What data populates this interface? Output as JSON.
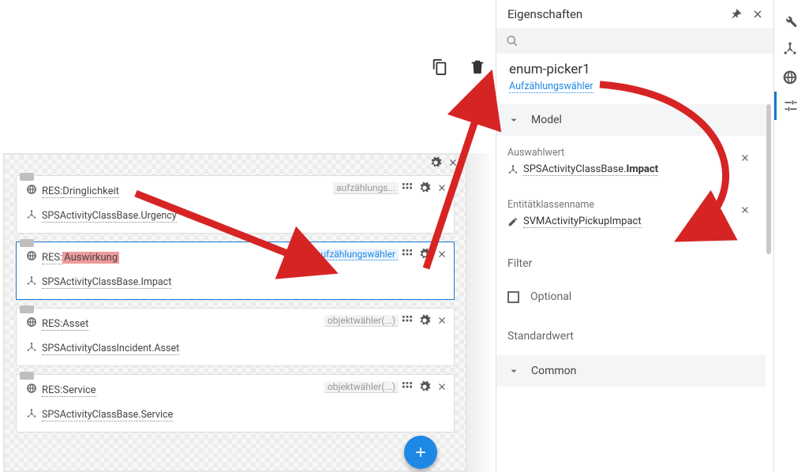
{
  "rail": {
    "items": [
      "wrench",
      "flow",
      "globe",
      "sliders"
    ]
  },
  "properties": {
    "title": "Eigenschaften",
    "component_id": "enum-picker1",
    "component_type": "Aufzählungswähler",
    "sections": {
      "model": {
        "title": "Model",
        "auswahlwert_label": "Auswahlwert",
        "auswahlwert_prefix": "SPSActivityClassBase.",
        "auswahlwert_bold": "Impact",
        "entitaet_label": "Entitätklassenname",
        "entitaet_value": "SVMActivityPickupImpact",
        "filter_label": "Filter",
        "optional_label": "Optional",
        "standardwert_label": "Standardwert"
      },
      "common": {
        "title": "Common"
      }
    }
  },
  "cards": [
    {
      "res_prefix": "RES:",
      "res_name": "Dringlichkeit",
      "badge": "aufzählungs...",
      "badge_active": false,
      "path_prefix": "SPSActivityClassBase.",
      "path_tail": "Urgency",
      "selected": false,
      "highlight_name": false
    },
    {
      "res_prefix": "RES:",
      "res_name": "Auswirkung",
      "badge": "aufzählungswähler",
      "badge_active": true,
      "path_prefix": "SPSActivityClassBase.",
      "path_tail": "Impact",
      "selected": true,
      "highlight_name": true
    },
    {
      "res_prefix": "RES:",
      "res_name": "Asset",
      "badge": "objektwähler(...)",
      "badge_active": false,
      "path_prefix": "SPSActivityClassIncident.",
      "path_tail": "Asset",
      "selected": false,
      "highlight_name": false
    },
    {
      "res_prefix": "RES:",
      "res_name": "Service",
      "badge": "objektwähler(...)",
      "badge_active": false,
      "path_prefix": "SPSActivityClassBase.",
      "path_tail": "Service",
      "selected": false,
      "highlight_name": false
    }
  ]
}
